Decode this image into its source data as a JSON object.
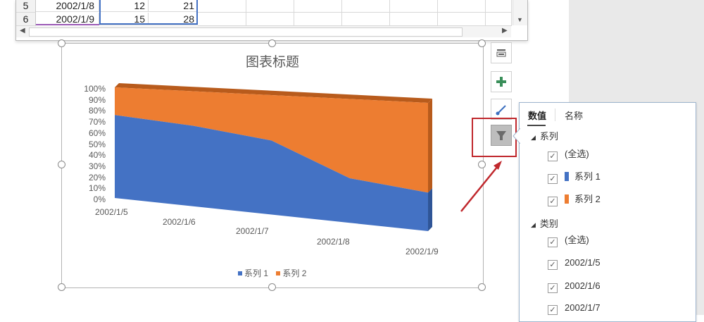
{
  "sheet": {
    "rows": [
      {
        "num": "5",
        "date": "2002/1/8",
        "a": "12",
        "b": "21"
      },
      {
        "num": "6",
        "date": "2002/1/9",
        "a": "15",
        "b": "28"
      }
    ]
  },
  "chart": {
    "title": "图表标题",
    "y_ticks": [
      "100%",
      "90%",
      "80%",
      "70%",
      "60%",
      "50%",
      "40%",
      "30%",
      "20%",
      "10%",
      "0%"
    ],
    "x_ticks": [
      "2002/1/5",
      "2002/1/6",
      "2002/1/7",
      "2002/1/8",
      "2002/1/9"
    ],
    "legend": [
      {
        "name": "系列 1",
        "color": "#4472c4"
      },
      {
        "name": "系列 2",
        "color": "#ed7d31"
      }
    ]
  },
  "chart_data": {
    "type": "area",
    "title": "图表标题",
    "categories": [
      "2002/1/5",
      "2002/1/6",
      "2002/1/7",
      "2002/1/8",
      "2002/1/9"
    ],
    "series": [
      {
        "name": "系列 1",
        "values": [
          0.75,
          0.7,
          0.62,
          0.36,
          0.3
        ],
        "color": "#4472c4"
      },
      {
        "name": "系列 2",
        "values": [
          0.25,
          0.3,
          0.38,
          0.64,
          0.7
        ],
        "color": "#ed7d31"
      }
    ],
    "ylim": [
      0,
      1
    ],
    "stacked_percent": true,
    "legend_position": "bottom"
  },
  "panel": {
    "tabs": [
      "数值",
      "名称"
    ],
    "series_header": "系列",
    "series_items": [
      {
        "label": "(全选)",
        "color": ""
      },
      {
        "label": "系列 1",
        "color": "#4472c4"
      },
      {
        "label": "系列 2",
        "color": "#ed7d31"
      }
    ],
    "category_header": "类别",
    "category_items": [
      "(全选)",
      "2002/1/5",
      "2002/1/6",
      "2002/1/7"
    ]
  },
  "icons": {
    "styles_btn": "layout-icon",
    "add_btn": "plus-icon",
    "brush_btn": "brush-icon",
    "filter_btn": "filter-icon"
  },
  "colors": {
    "series1": "#4472c4",
    "series2": "#ed7d31",
    "annotation": "#c0282d"
  }
}
